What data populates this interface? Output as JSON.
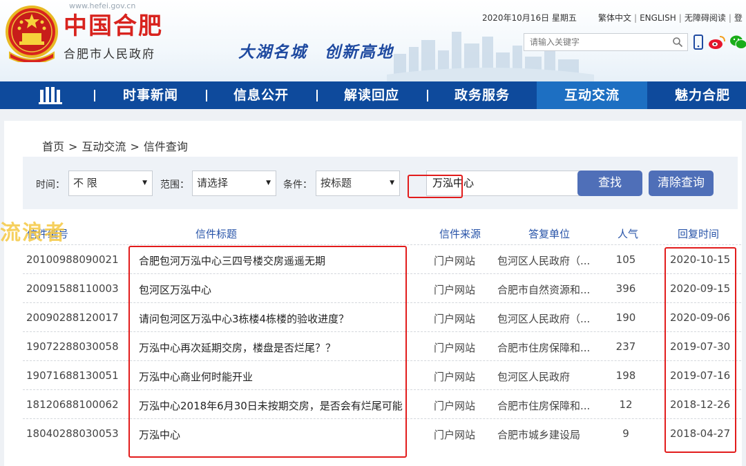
{
  "header": {
    "url": "www.hefei.gov.cn",
    "title": "中国合肥",
    "subtitle": "合肥市人民政府",
    "slogan": "大湖名城　创新高地",
    "date": "2020年10月16日 星期五",
    "links": [
      "繁体中文",
      "ENGLISH",
      "无障碍阅读",
      "登"
    ],
    "search_placeholder": "请输入关键字"
  },
  "nav": {
    "items": [
      {
        "label": "时事新闻"
      },
      {
        "label": "信息公开"
      },
      {
        "label": "解读回应"
      },
      {
        "label": "政务服务"
      },
      {
        "label": "互动交流",
        "active": true
      },
      {
        "label": "魅力合肥"
      }
    ]
  },
  "breadcrumb": [
    "首页",
    "互动交流",
    "信件查询"
  ],
  "filter": {
    "time_label": "时间：",
    "time_value": "不 限",
    "scope_label": "范围：",
    "scope_value": "请选择",
    "cond_label": "条件：",
    "cond_value": "按标题",
    "keyword": "万泓中心",
    "search_btn": "查找",
    "clear_btn": "清除查询"
  },
  "table": {
    "headers": [
      "信件编号",
      "信件标题",
      "信件来源",
      "答复单位",
      "人气",
      "回复时间"
    ],
    "header_visible_id_tail": "号",
    "rows": [
      {
        "id": "20100988090021",
        "title": "合肥包河万泓中心三四号楼交房遥遥无期",
        "source": "门户网站",
        "unit": "包河区人民政府（...",
        "views": "105",
        "date": "2020-10-15"
      },
      {
        "id": "20091588110003",
        "title": "包河区万泓中心",
        "source": "门户网站",
        "unit": "合肥市自然资源和...",
        "views": "396",
        "date": "2020-09-15"
      },
      {
        "id": "20090288120017",
        "title": "请问包河区万泓中心3栋楼4栋楼的验收进度？",
        "source": "门户网站",
        "unit": "包河区人民政府（...",
        "views": "190",
        "date": "2020-09-06"
      },
      {
        "id": "19072288030058",
        "title": "万泓中心再次延期交房，楼盘是否烂尾？？",
        "source": "门户网站",
        "unit": "合肥市住房保障和...",
        "views": "237",
        "date": "2019-07-30"
      },
      {
        "id": "19071688130051",
        "title": "万泓中心商业何时能开业",
        "source": "门户网站",
        "unit": "包河区人民政府",
        "views": "198",
        "date": "2019-07-16"
      },
      {
        "id": "18120688100062",
        "title": "万泓中心2018年6月30日未按期交房，是否会有烂尾可能",
        "source": "门户网站",
        "unit": "合肥市住房保障和...",
        "views": "12",
        "date": "2018-12-26"
      },
      {
        "id": "18040288030053",
        "title": "万泓中心",
        "source": "门户网站",
        "unit": "合肥市城乡建设局",
        "views": "9",
        "date": "2018-04-27"
      }
    ]
  },
  "watermark": "流浪者",
  "colors": {
    "nav": "#0e4a9c",
    "nav_active": "#1d6fc2",
    "brand_red": "#d8231e",
    "button": "#4f6fb8",
    "highlight": "#e21b1b"
  }
}
